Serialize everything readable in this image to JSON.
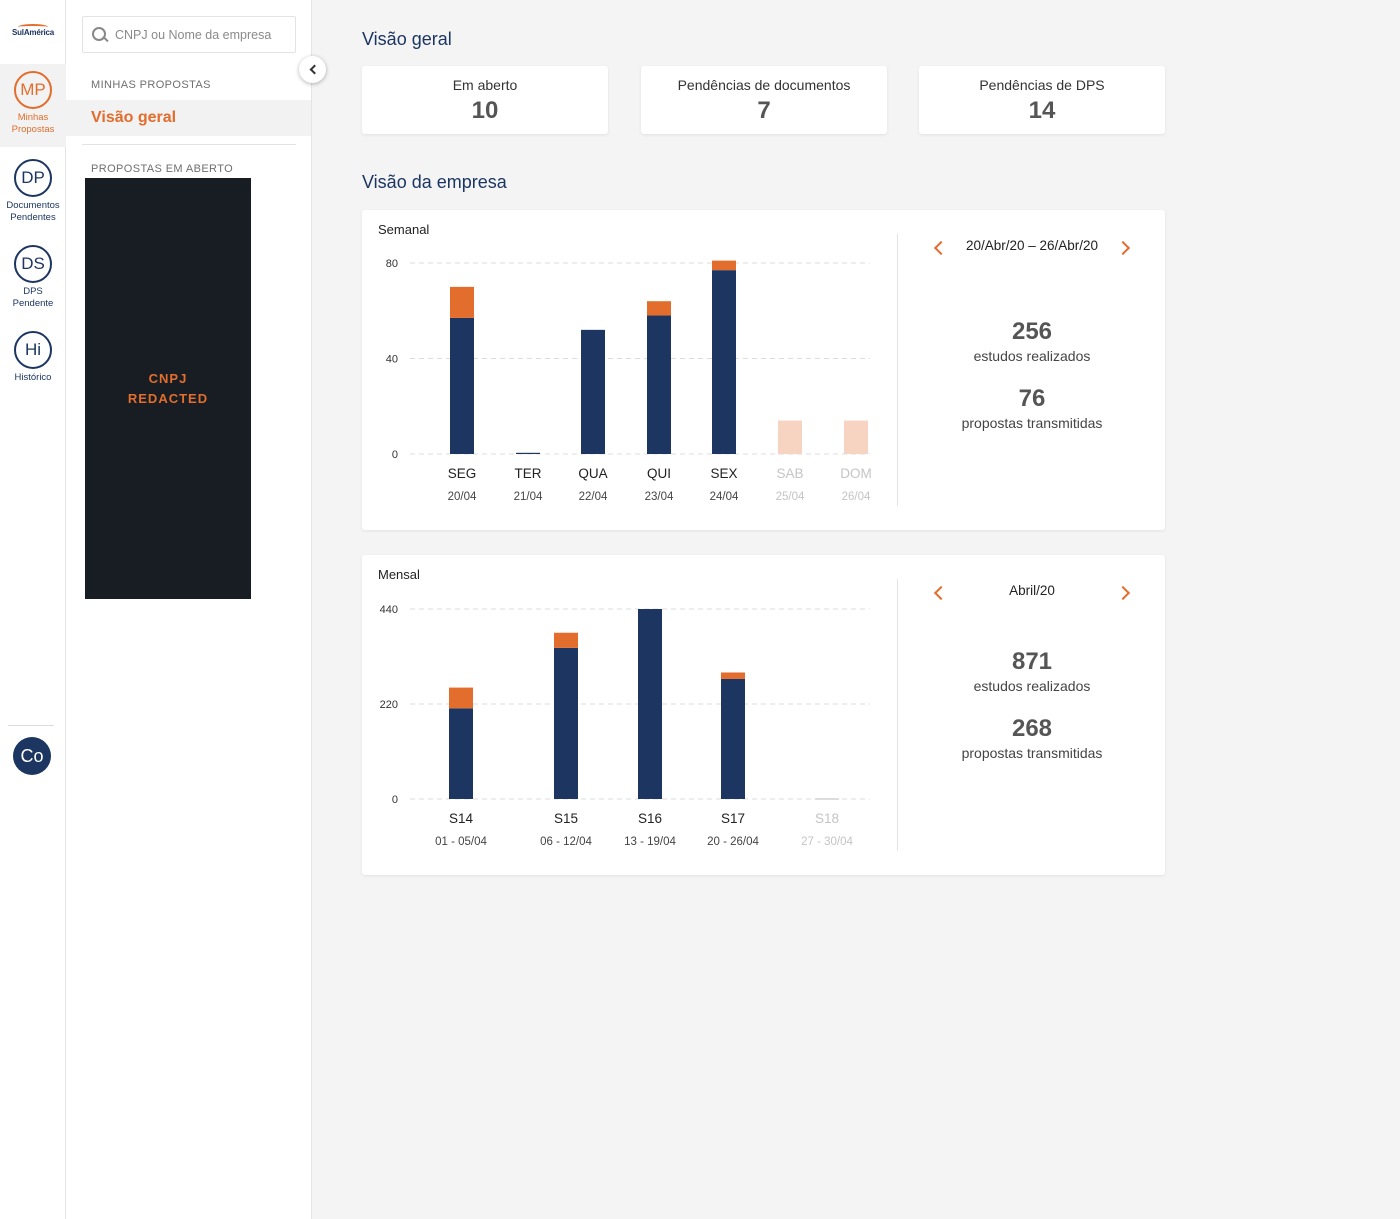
{
  "brand": {
    "logo_text": "SulAmérica"
  },
  "rail": {
    "items": [
      {
        "abbr": "MP",
        "label_1": "Minhas",
        "label_2": "Propostas"
      },
      {
        "abbr": "DP",
        "label_1": "Documentos",
        "label_2": "Pendentes"
      },
      {
        "abbr": "DS",
        "label_1": "DPS",
        "label_2": "Pendente"
      },
      {
        "abbr": "Hi",
        "label_1": "Histórico"
      }
    ],
    "user_initials": "Co"
  },
  "sidebar": {
    "search_placeholder": "CNPJ ou Nome da empresa",
    "section_my": "MINHAS PROPOSTAS",
    "active_item": "Visão geral",
    "section_open": "PROPOSTAS EM ABERTO",
    "redacted_1": "CNPJ",
    "redacted_2": "REDACTED"
  },
  "overview": {
    "title": "Visão geral",
    "cards": [
      {
        "label": "Em aberto",
        "value": "10"
      },
      {
        "label": "Pendências de documentos",
        "value": "7"
      },
      {
        "label": "Pendências de DPS",
        "value": "14"
      }
    ]
  },
  "company": {
    "title": "Visão da empresa",
    "weekly": {
      "label": "Semanal",
      "period": "20/Abr/20 – 26/Abr/20",
      "studies_value": "256",
      "studies_label": "estudos realizados",
      "proposals_value": "76",
      "proposals_label": "propostas transmitidas"
    },
    "monthly": {
      "label": "Mensal",
      "period": "Abril/20",
      "studies_value": "871",
      "studies_label": "estudos realizados",
      "proposals_value": "268",
      "proposals_label": "propostas transmitidas"
    }
  },
  "colors": {
    "navy": "#1c3661",
    "orange": "#e26d2c",
    "placeholder": "#f7d4c2",
    "muted": "#c4c4c4"
  },
  "chart_data": [
    {
      "type": "bar",
      "title": "Semanal",
      "stacked": true,
      "categories": [
        "SEG",
        "TER",
        "QUA",
        "QUI",
        "SEX",
        "SAB",
        "DOM"
      ],
      "sublabels": [
        "20/04",
        "21/04",
        "22/04",
        "23/04",
        "24/04",
        "25/04",
        "26/04"
      ],
      "muted": [
        false,
        false,
        false,
        false,
        false,
        true,
        true
      ],
      "series": [
        {
          "values": [
            57,
            0.5,
            52,
            58,
            77,
            0,
            0
          ],
          "color": "#1c3661"
        },
        {
          "values": [
            13,
            0,
            0,
            6,
            4,
            0,
            0
          ],
          "color": "#e26d2c"
        }
      ],
      "placeholder_values": [
        0,
        0,
        0,
        0,
        0,
        14,
        14
      ],
      "yticks": [
        0,
        40,
        80
      ],
      "ylim": [
        0,
        80
      ]
    },
    {
      "type": "bar",
      "title": "Mensal",
      "stacked": true,
      "categories": [
        "S14",
        "S15",
        "S16",
        "S17",
        "S18"
      ],
      "sublabels": [
        "01 - 05/04",
        "06 - 12/04",
        "13 - 19/04",
        "20 - 26/04",
        "27 - 30/04"
      ],
      "muted": [
        false,
        false,
        false,
        false,
        true
      ],
      "series": [
        {
          "values": [
            210,
            350,
            440,
            278,
            0
          ],
          "color": "#1c3661"
        },
        {
          "values": [
            48,
            35,
            0,
            15,
            0
          ],
          "color": "#e26d2c"
        }
      ],
      "yticks": [
        0,
        220,
        440
      ],
      "ylim": [
        0,
        440
      ]
    }
  ]
}
